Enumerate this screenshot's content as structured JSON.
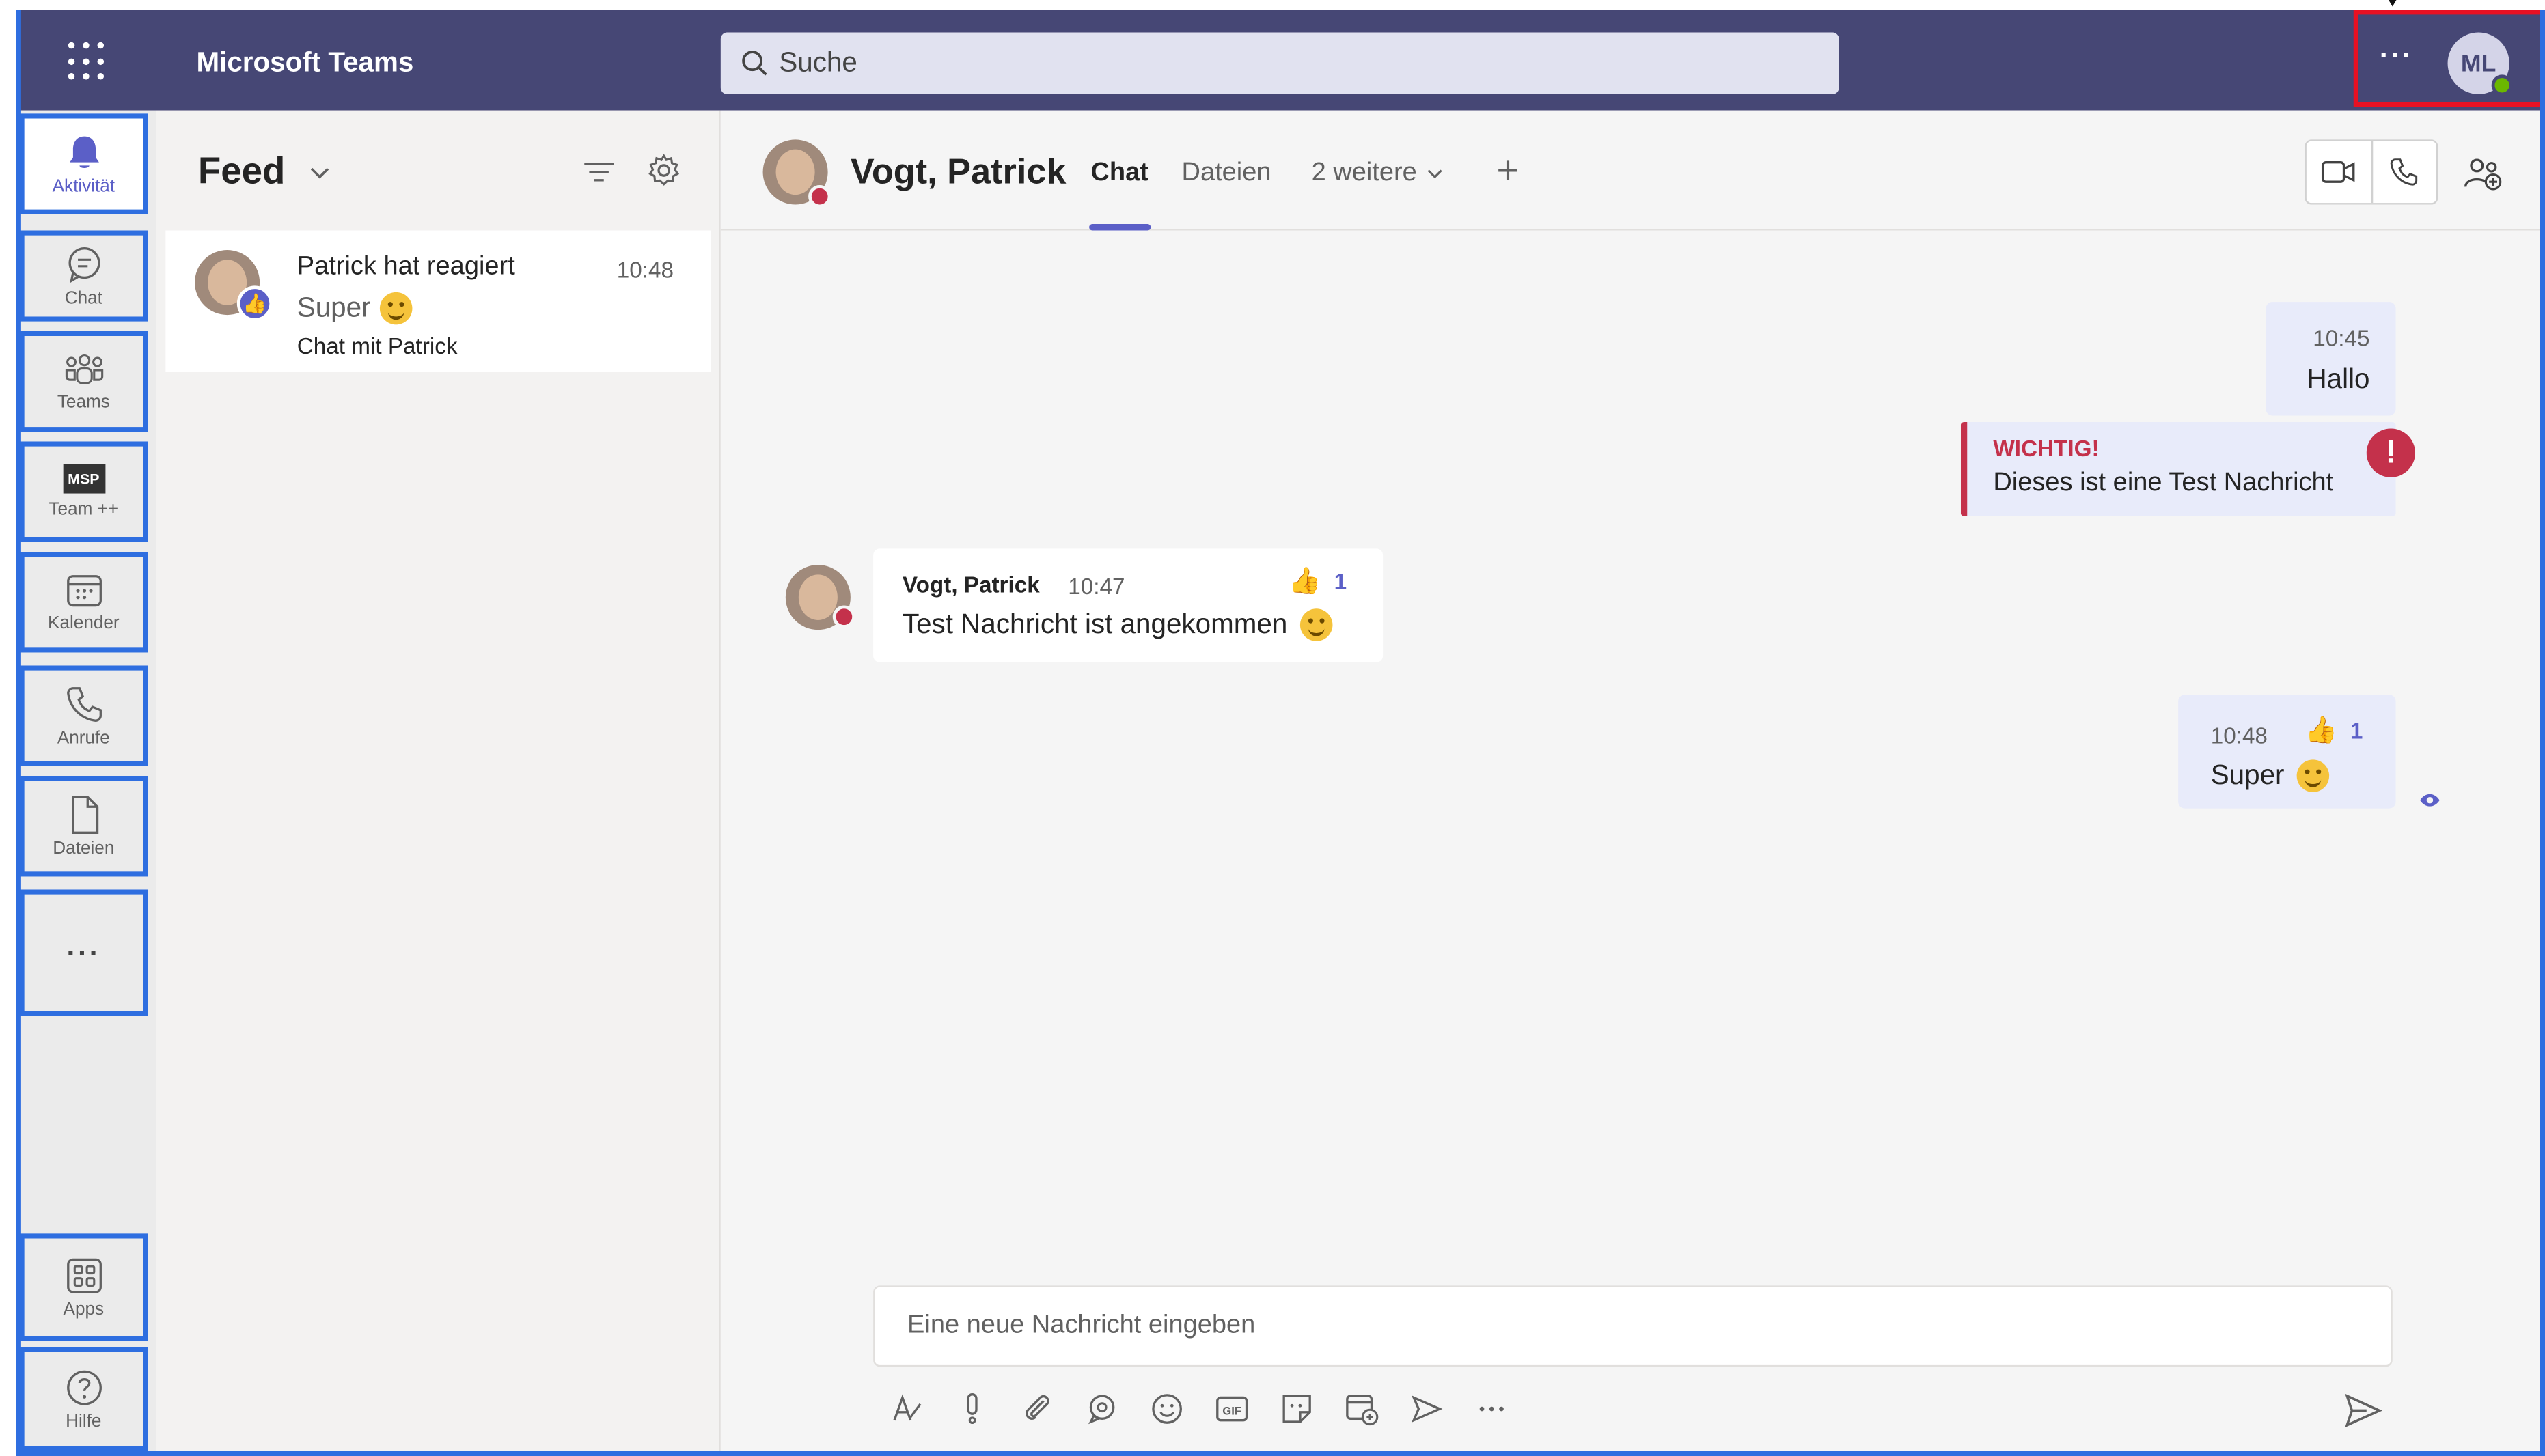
{
  "titlebar": {
    "app_title": "Microsoft Teams",
    "search_placeholder": "Suche",
    "more_label": "···",
    "user_initials": "ML"
  },
  "rail": {
    "items": [
      {
        "label": "Aktivität",
        "icon": "bell-icon"
      },
      {
        "label": "Chat",
        "icon": "chat-bubble-icon"
      },
      {
        "label": "Teams",
        "icon": "people-group-icon"
      },
      {
        "label": "Team ++",
        "icon": "msp-logo"
      },
      {
        "label": "Kalender",
        "icon": "calendar-icon"
      },
      {
        "label": "Anrufe",
        "icon": "phone-icon"
      },
      {
        "label": "Dateien",
        "icon": "file-icon"
      },
      {
        "label": "···",
        "icon": "more-icon"
      }
    ],
    "msp_text": "MSP",
    "bottom": [
      {
        "label": "Apps",
        "icon": "apps-icon"
      },
      {
        "label": "Hilfe",
        "icon": "help-icon"
      }
    ]
  },
  "feed": {
    "title": "Feed",
    "card": {
      "line1": "Patrick hat reagiert",
      "time": "10:48",
      "line2": "Super",
      "line3": "Chat mit Patrick"
    }
  },
  "chat": {
    "contact_name": "Vogt, Patrick",
    "tabs": {
      "chat": "Chat",
      "files": "Dateien",
      "more": "2 weitere"
    },
    "messages": {
      "out1": {
        "time": "10:45",
        "text": "Hallo"
      },
      "important": {
        "header": "WICHTIG!",
        "text": "Dieses ist eine Test Nachricht"
      },
      "in1": {
        "sender": "Vogt, Patrick",
        "time": "10:47",
        "reaction_count": "1",
        "text": "Test Nachricht ist angekommen"
      },
      "out2": {
        "time": "10:48",
        "reaction_count": "1",
        "text": "Super"
      }
    },
    "composer_placeholder": "Eine neue Nachricht eingeben"
  },
  "colors": {
    "titlebar": "#464775",
    "accent": "#5b5fc7",
    "important": "#c4314b",
    "outgoing_bubble": "#e8ebfa",
    "annotation_blue": "#2e6ee0",
    "annotation_red": "#e81123"
  }
}
